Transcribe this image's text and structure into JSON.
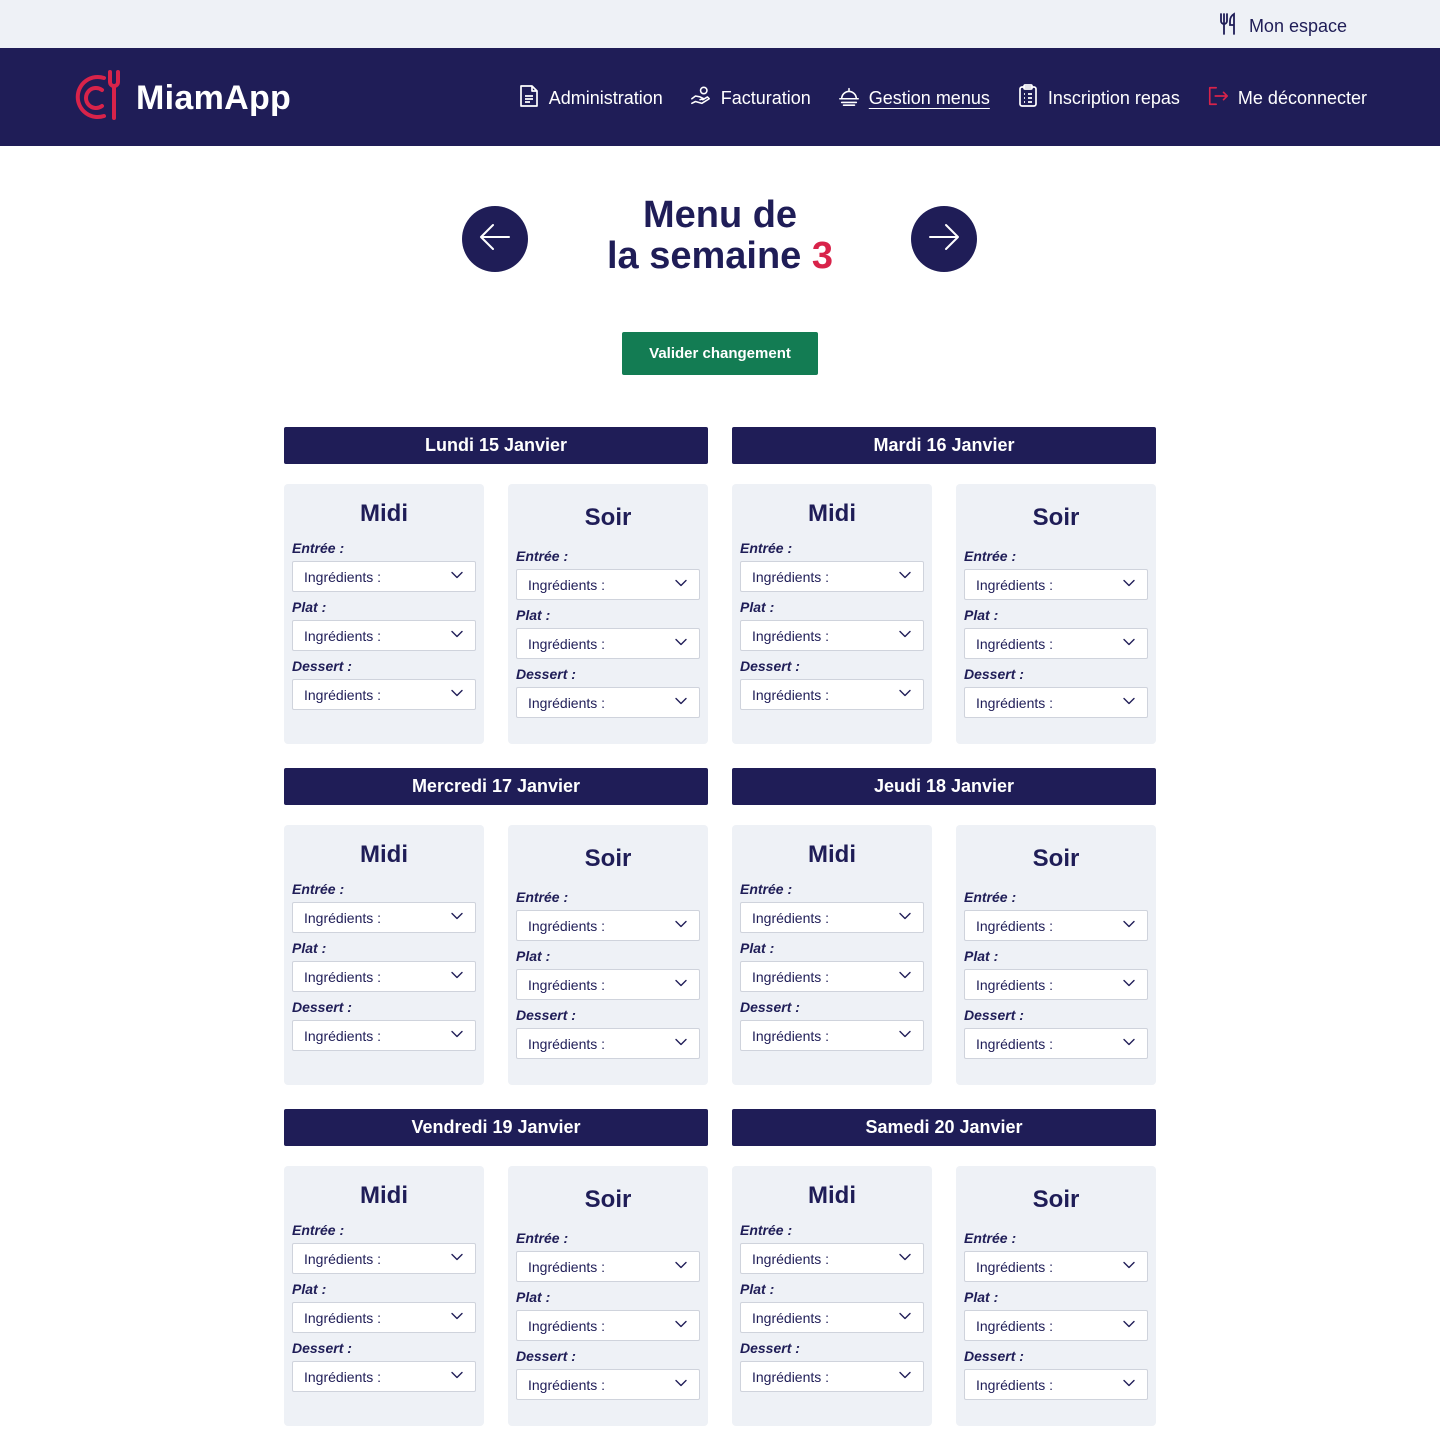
{
  "topbar": {
    "mon_espace": "Mon espace"
  },
  "brand": {
    "name": "MiamApp",
    "accent_color": "#d8234a",
    "primary_color": "#1f1d57",
    "success_color": "#137c53"
  },
  "nav": {
    "items": [
      {
        "label": "Administration",
        "icon": "document-icon"
      },
      {
        "label": "Facturation",
        "icon": "hand-coin-icon"
      },
      {
        "label": "Gestion menus",
        "icon": "cloche-icon",
        "active": true
      },
      {
        "label": "Inscription repas",
        "icon": "clipboard-icon"
      },
      {
        "label": "Me déconnecter",
        "icon": "logout-icon"
      }
    ]
  },
  "week": {
    "title_line1": "Menu de",
    "title_line2": "la semaine",
    "number": "3"
  },
  "actions": {
    "validate_label": "Valider changement"
  },
  "meal_labels": {
    "midi": "Midi",
    "soir": "Soir"
  },
  "course_labels": {
    "entree": "Entrée :",
    "plat": "Plat :",
    "dessert": "Dessert :"
  },
  "select_placeholder": "Ingrédients :",
  "days": [
    {
      "label": "Lundi 15 Janvier"
    },
    {
      "label": "Mardi 16 Janvier"
    },
    {
      "label": "Mercredi 17 Janvier"
    },
    {
      "label": "Jeudi 18 Janvier"
    },
    {
      "label": "Vendredi 19 Janvier"
    },
    {
      "label": "Samedi 20 Janvier"
    }
  ]
}
